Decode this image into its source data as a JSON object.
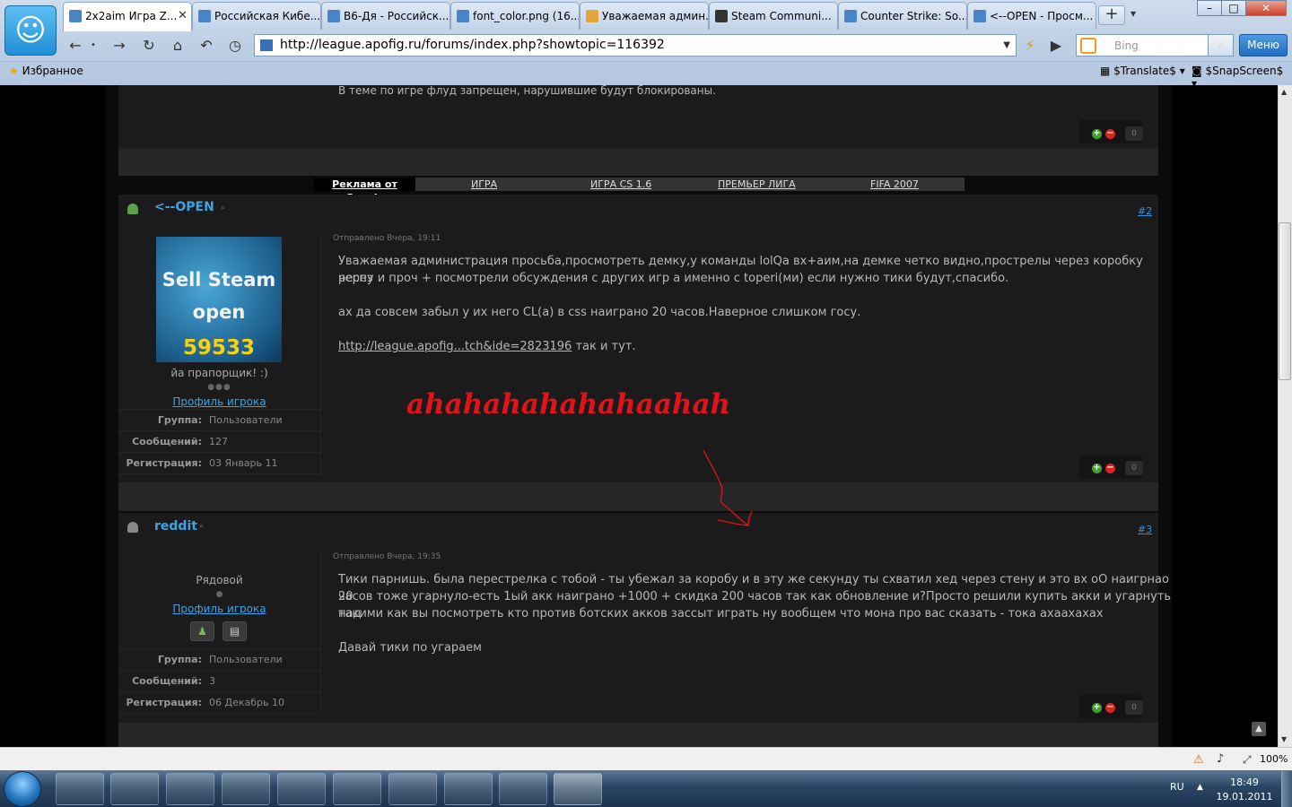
{
  "browser": {
    "tabs": [
      {
        "title": "2x2aim Игра Z...",
        "active": true
      },
      {
        "title": "Российская Кибе...",
        "active": false
      },
      {
        "title": "В6-Дя - Российск...",
        "active": false
      },
      {
        "title": "font_color.png (16...",
        "active": false
      },
      {
        "title": "Уважаемая админ...",
        "active": false
      },
      {
        "title": "Steam Communi...",
        "active": false
      },
      {
        "title": "Counter Strike: So...",
        "active": false
      },
      {
        "title": "<--OPEN - Просм...",
        "active": false
      }
    ],
    "new_tab": "+",
    "url": "http://league.apofig.ru/forums/index.php?showtopic=116392",
    "search_placeholder": "Bing",
    "menu_label": "Меню",
    "favorites_label": "Избранное",
    "translate_label": "$Translate$",
    "snapscreen_label": "$SnapScreen$",
    "window_buttons": [
      "–",
      "□",
      "✕"
    ],
    "zoom": "100%"
  },
  "forum": {
    "top_notice": "В теме по игре флуд запрещен, нарушившие будут блокированы.",
    "rep_count": "0",
    "ad_bar": {
      "label": "Реклама от Google",
      "links": [
        "ИГРА",
        "ИГРА CS 1.6",
        "ПРЕМЬЕР ЛИГА",
        "FIFA 2007"
      ]
    },
    "posts": [
      {
        "author": "<--OPEN",
        "number": "#2",
        "posted": "Отправлено Вчера, 19:11",
        "avatar_lines": [
          "Sell Steam",
          "open",
          "59533"
        ],
        "rank": "йа прапорщик! :)",
        "profile_link": "Профиль игрока",
        "fields": [
          {
            "label": "Группа:",
            "value": "Пользователи"
          },
          {
            "label": "Сообщений:",
            "value": "127"
          },
          {
            "label": "Регистрация:",
            "value": "03 Январь 11"
          }
        ],
        "body": [
          "Уважаемая администрация просьба,просмотреть демку,у команды lolQa вх+аим,на демке четко видно,прострелы через коробку через",
          "респу и проч + посмотрели обсуждения с других игр а именно с toperi(ми) если нужно тики будут,спасибо.",
          "ах да совсем забыл у их него CL(a) в css наиграно 20 часов.Наверное слишком госу."
        ],
        "link_text": "http://league.apofig...tch&ide=2823196",
        "link_suffix": " так и тут.",
        "overlay_text": "ahahahahahahaahah"
      },
      {
        "author": "reddit",
        "number": "#3",
        "posted": "Отправлено Вчера, 19:35",
        "rank": "Рядовой",
        "profile_link": "Профиль игрока",
        "fields": [
          {
            "label": "Группа:",
            "value": "Пользователи"
          },
          {
            "label": "Сообщений:",
            "value": "3"
          },
          {
            "label": "Регистрация:",
            "value": "06 Декабрь 10"
          }
        ],
        "body": [
          "Тики парнишь. была перестрелка с тобой - ты убежал за коробу и в эту же секунду ты схватил хед через стену и это вх оО наигрнао 20",
          "часов тоже угарнуло-есть 1ый акк наиграно +1000 + скидка 200 часов так как обновление и?Просто решили купить акки и угарнуть над",
          "такими как вы посмотреть кто против ботских акков зассыт играть ну вообщем что мона про вас сказать - тока ахаахахах",
          "Давай тики по угараем"
        ]
      }
    ]
  },
  "taskbar": {
    "lang": "RU",
    "time": "18:49",
    "date": "19.01.2011"
  }
}
